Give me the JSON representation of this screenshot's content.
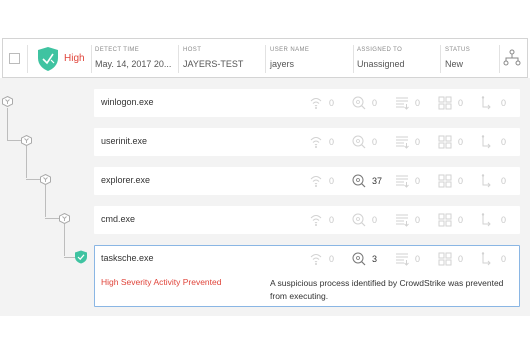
{
  "detection": {
    "severity": "High",
    "severity_color": "#e0443a",
    "shield_color": "#3fc3a1",
    "columns": [
      {
        "label": "DETECT TIME",
        "value": "May. 14, 2017 20..."
      },
      {
        "label": "HOST",
        "value": "JAYERS-TEST"
      },
      {
        "label": "USER NAME",
        "value": "jayers"
      },
      {
        "label": "ASSIGNED TO",
        "value": "Unassigned"
      },
      {
        "label": "STATUS",
        "value": "New"
      }
    ],
    "icons": {
      "shield": "shield-check-icon",
      "tree": "process-tree-icon"
    }
  },
  "stat_icons": [
    "network-icon",
    "dns-lookup-icon",
    "disk-write-icon",
    "modules-icon",
    "child-processes-icon"
  ],
  "processes": [
    {
      "name": "winlogon.exe",
      "stats": [
        "0",
        "0",
        "0",
        "0",
        "0"
      ]
    },
    {
      "name": "userinit.exe",
      "stats": [
        "0",
        "0",
        "0",
        "0",
        "0"
      ]
    },
    {
      "name": "explorer.exe",
      "stats": [
        "0",
        "37",
        "0",
        "0",
        "0"
      ]
    },
    {
      "name": "cmd.exe",
      "stats": [
        "0",
        "0",
        "0",
        "0",
        "0"
      ]
    },
    {
      "name": "tasksche.exe",
      "stats": [
        "0",
        "3",
        "0",
        "0",
        "0"
      ]
    }
  ],
  "selected": {
    "title": "High Severity Activity Prevented",
    "description": "A suspicious process identified by CrowdStrike was prevented from executing."
  }
}
